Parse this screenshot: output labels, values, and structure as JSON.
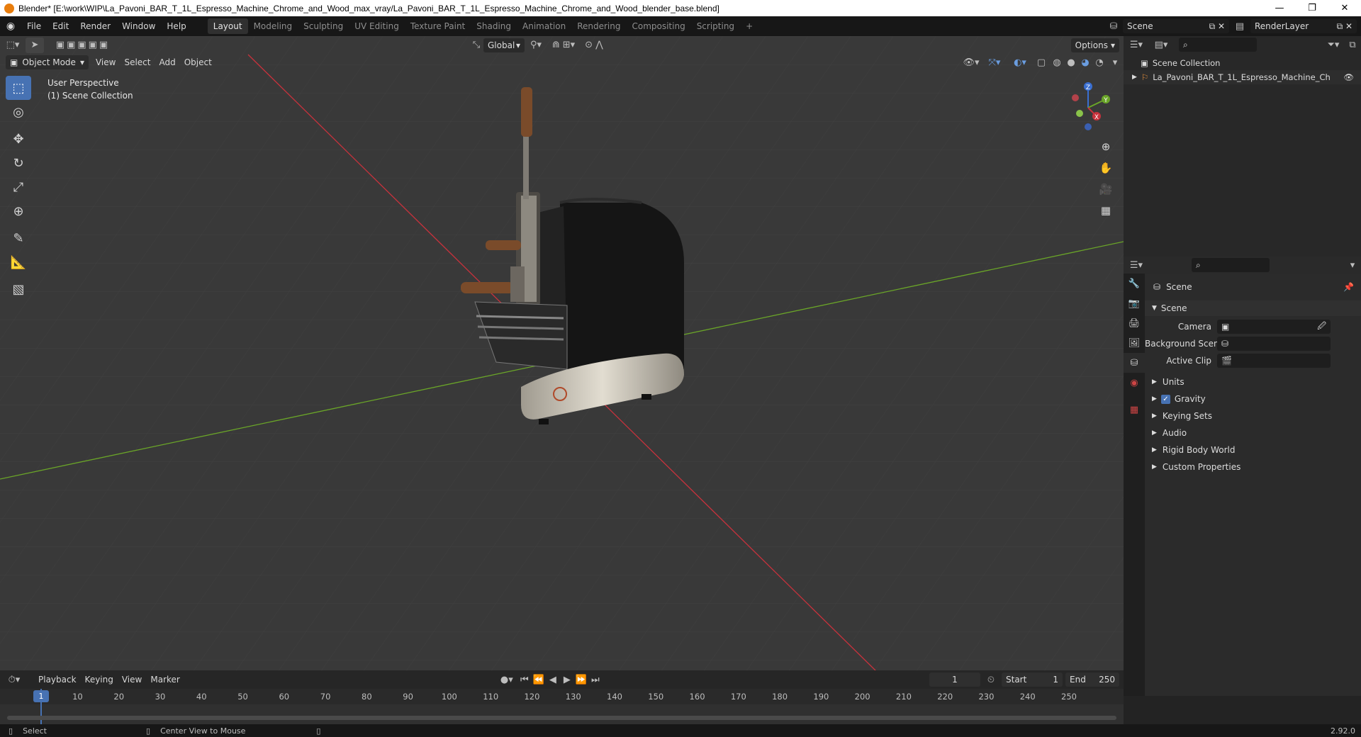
{
  "window": {
    "title": "Blender* [E:\\work\\WIP\\La_Pavoni_BAR_T_1L_Espresso_Machine_Chrome_and_Wood_max_vray/La_Pavoni_BAR_T_1L_Espresso_Machine_Chrome_and_Wood_blender_base.blend]",
    "minimize": "—",
    "restore": "❐",
    "close": "✕"
  },
  "menu": [
    "File",
    "Edit",
    "Render",
    "Window",
    "Help"
  ],
  "workspaces": [
    "Layout",
    "Modeling",
    "Sculpting",
    "UV Editing",
    "Texture Paint",
    "Shading",
    "Animation",
    "Rendering",
    "Compositing",
    "Scripting"
  ],
  "add_workspace": "+",
  "scene_field": "Scene",
  "render_layer_field": "RenderLayer",
  "toolbar": {
    "orientation": "Global",
    "options": "Options"
  },
  "viewport_header": {
    "mode": "Object Mode",
    "items": [
      "View",
      "Select",
      "Add",
      "Object"
    ]
  },
  "viewport_info": {
    "perspective": "User Perspective",
    "collection": "(1) Scene Collection"
  },
  "gizmo": {
    "z": "Z",
    "y": "Y",
    "x": "X"
  },
  "outliner": {
    "root": "Scene Collection",
    "object": "La_Pavoni_BAR_T_1L_Espresso_Machine_Ch"
  },
  "properties": {
    "context": "Scene",
    "panel": "Scene",
    "camera_label": "Camera",
    "background_label": "Background Scene",
    "clip_label": "Active Clip",
    "sections": [
      "Units",
      "Gravity",
      "Keying Sets",
      "Audio",
      "Rigid Body World",
      "Custom Properties"
    ],
    "gravity_checked": true
  },
  "timeline": {
    "menus": [
      "Playback",
      "Keying",
      "View",
      "Marker"
    ],
    "current_frame": "1",
    "start_label": "Start",
    "start": "1",
    "end_label": "End",
    "end": "250",
    "ticks": [
      "1",
      "10",
      "20",
      "30",
      "40",
      "50",
      "60",
      "70",
      "80",
      "90",
      "100",
      "110",
      "120",
      "130",
      "140",
      "150",
      "160",
      "170",
      "180",
      "190",
      "200",
      "210",
      "220",
      "230",
      "240",
      "250"
    ]
  },
  "status": {
    "select": "Select",
    "center_view": "Center View to Mouse",
    "version": "2.92.0"
  },
  "colors": {
    "accent": "#4772b3",
    "axis_x": "#c8323c",
    "axis_y": "#6aa528",
    "viewport_bg": "#393939"
  }
}
